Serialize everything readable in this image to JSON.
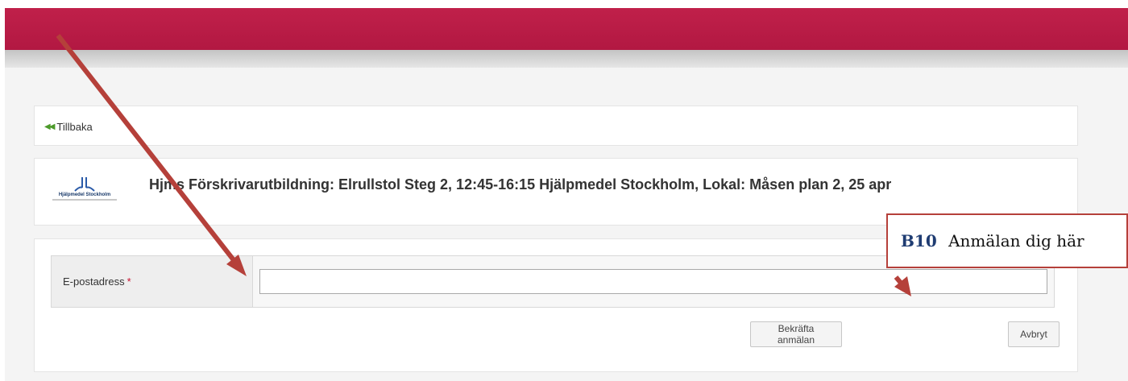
{
  "nav": {
    "back_label": "Tillbaka"
  },
  "logo": {
    "text": "Hjälpmedel Stockholm"
  },
  "course": {
    "title": "Hjms Förskrivarutbildning: Elrullstol Steg 2, 12:45-16:15 Hjälpmedel Stockholm, Lokal: Måsen plan 2, 25 apr"
  },
  "form": {
    "email_label": "E-postadress",
    "required_marker": "*",
    "email_value": "",
    "confirm_label": "Bekräfta anmälan",
    "cancel_label": "Avbryt"
  },
  "callout": {
    "code": "B10",
    "text": "Anmälan dig här"
  },
  "colors": {
    "header": "#b51b45",
    "annotation_arrow": "#b5403a",
    "callout_code": "#1f3c72"
  }
}
